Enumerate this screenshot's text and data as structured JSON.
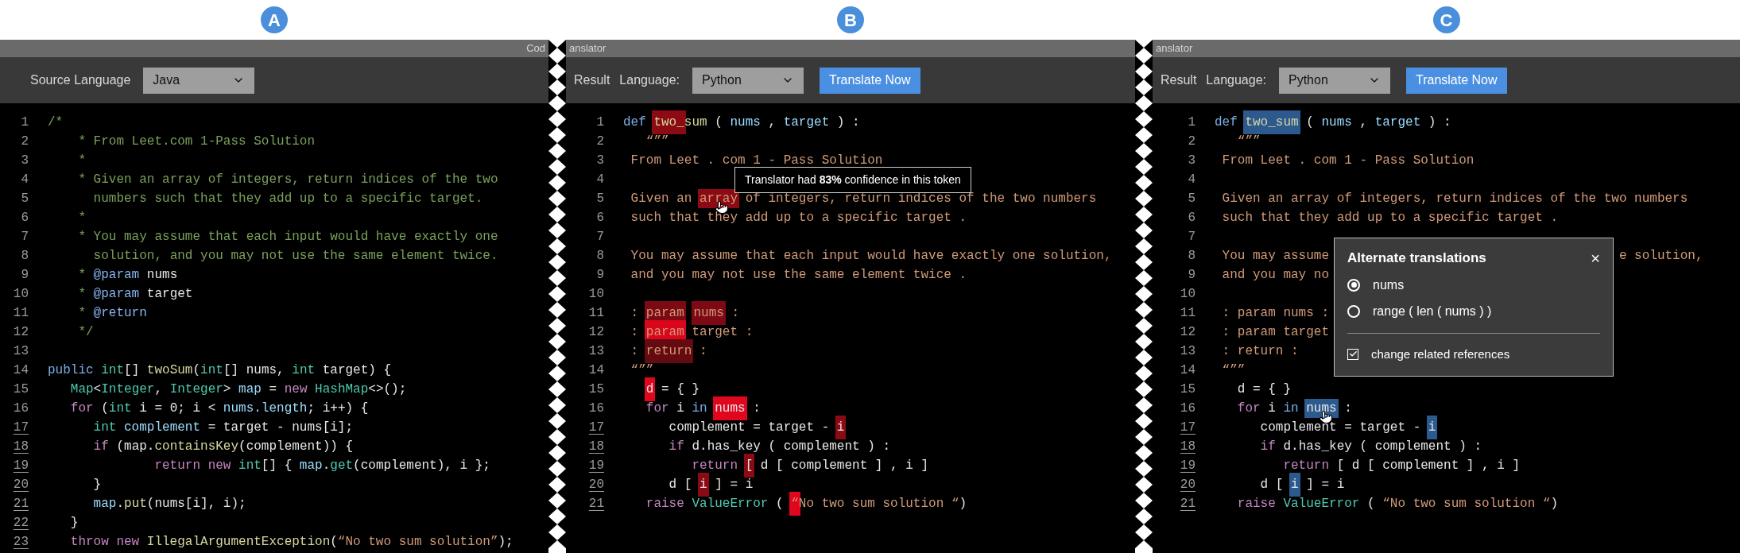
{
  "panels": [
    {
      "label": "A",
      "title": "Cod",
      "toolbar": {
        "labels": [
          "Source Language"
        ],
        "dropdown": "Java"
      },
      "lines": [
        {
          "number": "1",
          "underlined": false,
          "tokens": [
            {
              "text": "/*",
              "kind": "comment"
            }
          ]
        },
        {
          "number": "2",
          "underlined": false,
          "tokens": [
            {
              "text": "    * From Leet.com 1-Pass Solution",
              "kind": "comment"
            }
          ]
        },
        {
          "number": "3",
          "underlined": false,
          "tokens": [
            {
              "text": "    *",
              "kind": "comment"
            }
          ]
        },
        {
          "number": "4",
          "underlined": false,
          "tokens": [
            {
              "text": "    * Given an array of integers, return indices of the two",
              "kind": "comment"
            }
          ]
        },
        {
          "number": "5",
          "underlined": false,
          "tokens": [
            {
              "text": "      numbers such that they add up to a specific target.",
              "kind": "comment"
            }
          ]
        },
        {
          "number": "6",
          "underlined": false,
          "tokens": [
            {
              "text": "    *",
              "kind": "comment"
            }
          ]
        },
        {
          "number": "7",
          "underlined": false,
          "tokens": [
            {
              "text": "    * You may assume that each input would have exactly one",
              "kind": "comment"
            }
          ]
        },
        {
          "number": "8",
          "underlined": false,
          "tokens": [
            {
              "text": "      solution, and you may not use the same element twice.",
              "kind": "comment"
            }
          ]
        },
        {
          "number": "9",
          "underlined": false,
          "tokens": [
            {
              "text": "    * ",
              "kind": "comment"
            },
            {
              "text": "@param",
              "kind": "doctag"
            },
            {
              "text": " nums",
              "kind": "plain"
            }
          ]
        },
        {
          "number": "10",
          "underlined": false,
          "tokens": [
            {
              "text": "    * ",
              "kind": "comment"
            },
            {
              "text": "@param",
              "kind": "doctag"
            },
            {
              "text": " target",
              "kind": "plain"
            }
          ]
        },
        {
          "number": "11",
          "underlined": false,
          "tokens": [
            {
              "text": "    * ",
              "kind": "comment"
            },
            {
              "text": "@return",
              "kind": "doctag"
            }
          ]
        },
        {
          "number": "12",
          "underlined": false,
          "tokens": [
            {
              "text": "    */",
              "kind": "comment"
            }
          ]
        },
        {
          "number": "13",
          "underlined": false
        },
        {
          "number": "14",
          "underlined": false,
          "tokens": [
            {
              "text": "public ",
              "kind": "storage"
            },
            {
              "text": "int",
              "kind": "type"
            },
            {
              "text": "[] ",
              "kind": "plain"
            },
            {
              "text": "twoSum",
              "kind": "func"
            },
            {
              "text": "(",
              "kind": "plain"
            },
            {
              "text": "int",
              "kind": "type"
            },
            {
              "text": "[] nums, ",
              "kind": "plain"
            },
            {
              "text": "int",
              "kind": "type"
            },
            {
              "text": " target) {",
              "kind": "plain"
            }
          ],
          "children": [
            {
              "number": "15",
              "underlined": false,
              "tokens": [
                {
                  "text": "Map",
                  "kind": "type"
                },
                {
                  "text": "<",
                  "kind": "plain"
                },
                {
                  "text": "Integer",
                  "kind": "type"
                },
                {
                  "text": ", ",
                  "kind": "plain"
                },
                {
                  "text": "Integer",
                  "kind": "type"
                },
                {
                  "text": "> ",
                  "kind": "plain"
                },
                {
                  "text": "map",
                  "kind": "var"
                },
                {
                  "text": " = ",
                  "kind": "plain"
                },
                {
                  "text": "new ",
                  "kind": "keyword"
                },
                {
                  "text": "HashMap",
                  "kind": "type"
                },
                {
                  "text": "<>();",
                  "kind": "plain"
                }
              ]
            },
            {
              "number": "16",
              "underlined": false,
              "tokens": [
                {
                  "text": "for ",
                  "kind": "keyword"
                },
                {
                  "text": "(",
                  "kind": "plain"
                },
                {
                  "text": "int",
                  "kind": "type"
                },
                {
                  "text": " i = 0; i < ",
                  "kind": "plain"
                },
                {
                  "text": "nums.length",
                  "kind": "var"
                },
                {
                  "text": "; i++) {",
                  "kind": "plain"
                }
              ],
              "children": [
                {
                  "number": "17",
                  "underlined": true,
                  "tokens": [
                    {
                      "text": "int ",
                      "kind": "type"
                    },
                    {
                      "text": "complement",
                      "kind": "var"
                    },
                    {
                      "text": " = target - nums[i];",
                      "kind": "plain"
                    }
                  ]
                },
                {
                  "number": "18",
                  "underlined": true,
                  "tokens": [
                    {
                      "text": "if ",
                      "kind": "keyword"
                    },
                    {
                      "text": "(map.",
                      "kind": "plain"
                    },
                    {
                      "text": "containsKey",
                      "kind": "func"
                    },
                    {
                      "text": "(complement)) {",
                      "kind": "plain"
                    }
                  ],
                  "children": [
                    {
                      "number": "19",
                      "underlined": true,
                      "tokens": [
                        {
                          "text": "     return new ",
                          "kind": "keyword"
                        },
                        {
                          "text": "int",
                          "kind": "type"
                        },
                        {
                          "text": "[] { ",
                          "kind": "plain"
                        },
                        {
                          "text": "map",
                          "kind": "var"
                        },
                        {
                          "text": ".",
                          "kind": "plain"
                        },
                        {
                          "text": "get",
                          "kind": "type"
                        },
                        {
                          "text": "(complement), i };",
                          "kind": "plain"
                        }
                      ]
                    }
                  ]
                },
                {
                  "number": "20",
                  "underlined": true,
                  "tokens": [
                    {
                      "text": "}",
                      "kind": "plain"
                    }
                  ]
                },
                {
                  "number": "21",
                  "underlined": true,
                  "tokens": [
                    {
                      "text": "map",
                      "kind": "var"
                    },
                    {
                      "text": ".",
                      "kind": "plain"
                    },
                    {
                      "text": "put",
                      "kind": "func"
                    },
                    {
                      "text": "(nums[i], i);",
                      "kind": "plain"
                    }
                  ]
                }
              ]
            },
            {
              "number": "22",
              "underlined": true,
              "tokens": [
                {
                  "text": "}",
                  "kind": "plain"
                }
              ]
            },
            {
              "number": "23",
              "underlined": true,
              "tokens": [
                {
                  "text": "throw new ",
                  "kind": "keyword"
                },
                {
                  "text": "IllegalArgumentException",
                  "kind": "func"
                },
                {
                  "text": "(",
                  "kind": "plain"
                },
                {
                  "text": "“No two sum solution”",
                  "kind": "string"
                },
                {
                  "text": ");",
                  "kind": "plain"
                }
              ]
            }
          ]
        }
      ]
    },
    {
      "label": "B",
      "title": "anslator",
      "toolbar": {
        "labels": [
          "Result",
          "Language:"
        ],
        "dropdown": "Python",
        "button": "Translate Now"
      },
      "tooltip": {
        "text": "Translator had **83%** confidence in this token"
      },
      "lines": [
        {
          "number": "1",
          "underlined": false,
          "tokens": [
            {
              "text": "def ",
              "kind": "storage"
            },
            {
              "text": "two_",
              "kind": "func",
              "color": "#8b0a14"
            },
            {
              "text": "sum",
              "kind": "func"
            },
            {
              "text": " ( ",
              "kind": "plain"
            },
            {
              "text": "nums",
              "kind": "var"
            },
            {
              "text": " , ",
              "kind": "plain"
            },
            {
              "text": "target",
              "kind": "var"
            },
            {
              "text": " ) :",
              "kind": "plain"
            }
          ]
        },
        {
          "number": "2",
          "underlined": false,
          "tokens": [
            {
              "text": "   “””",
              "kind": "string"
            }
          ]
        },
        {
          "number": "3",
          "underlined": false,
          "tokens": [
            {
              "text": " From Leet . com 1 - Pass Solution",
              "kind": "string"
            }
          ]
        },
        {
          "number": "4",
          "underlined": false
        },
        {
          "number": "5",
          "underlined": false,
          "tokens": [
            {
              "text": " Given an ",
              "kind": "string"
            },
            {
              "text": "array",
              "kind": "string",
              "color": "#8b0a14",
              "pointer": true
            },
            {
              "text": " of integers, return indices of the two numbers",
              "kind": "string"
            }
          ]
        },
        {
          "number": "6",
          "underlined": false,
          "tokens": [
            {
              "text": " such that they add up to a specific target .",
              "kind": "string"
            }
          ]
        },
        {
          "number": "7",
          "underlined": false
        },
        {
          "number": "8",
          "underlined": false,
          "tokens": [
            {
              "text": " You may assume that each input would have exactly one solution,",
              "kind": "string"
            }
          ]
        },
        {
          "number": "9",
          "underlined": false,
          "tokens": [
            {
              "text": " and you may not use the same element twice .",
              "kind": "string"
            }
          ]
        },
        {
          "number": "10",
          "underlined": false
        },
        {
          "number": "11",
          "underlined": false,
          "tokens": [
            {
              "text": " : ",
              "kind": "string"
            },
            {
              "text": "param",
              "kind": "string",
              "color": "#7c0913"
            },
            {
              "text": "nums",
              "kind": "string",
              "color": "#7c0913"
            },
            {
              "text": " :",
              "kind": "string"
            }
          ]
        },
        {
          "number": "12",
          "underlined": false,
          "tokens": [
            {
              "text": " : ",
              "kind": "string"
            },
            {
              "text": "param",
              "kind": "string",
              "color": "#d9061c"
            },
            {
              "text": " target :",
              "kind": "string"
            }
          ]
        },
        {
          "number": "13",
          "underlined": false,
          "tokens": [
            {
              "text": " : ",
              "kind": "string"
            },
            {
              "text": "return",
              "kind": "string",
              "color": "#640a10"
            },
            {
              "text": " :",
              "kind": "string"
            }
          ]
        },
        {
          "number": "14",
          "underlined": false,
          "tokens": [
            {
              "text": " “””",
              "kind": "string"
            }
          ],
          "children": [
            {
              "number": "15",
              "underlined": false,
              "tokens": [
                {
                  "text": "d",
                  "kind": "plain",
                  "color": "#e0061d"
                },
                {
                  "text": " = { }",
                  "kind": "plain"
                }
              ]
            },
            {
              "number": "16",
              "underlined": false,
              "tokens": [
                {
                  "text": "for ",
                  "kind": "keyword"
                },
                {
                  "text": "i ",
                  "kind": "plain"
                },
                {
                  "text": "in ",
                  "kind": "storage"
                },
                {
                  "text": "nums",
                  "kind": "plain",
                  "color": "#e0061d"
                },
                {
                  "text": " :",
                  "kind": "plain"
                }
              ],
              "children": [
                {
                  "number": "17",
                  "underlined": true,
                  "tokens": [
                    {
                      "text": "complement = target - ",
                      "kind": "plain"
                    },
                    {
                      "text": "i",
                      "kind": "plain",
                      "color": "#8b0a14"
                    }
                  ]
                },
                {
                  "number": "18",
                  "underlined": true,
                  "tokens": [
                    {
                      "text": "if ",
                      "kind": "keyword"
                    },
                    {
                      "text": "d.has_key ( complement ) :",
                      "kind": "plain"
                    }
                  ],
                  "children": [
                    {
                      "number": "19",
                      "underlined": true,
                      "tokens": [
                        {
                          "text": "return ",
                          "kind": "keyword"
                        },
                        {
                          "text": "[",
                          "kind": "plain",
                          "color": "#8b0a14"
                        },
                        {
                          "text": " d [ complement ] , i ]",
                          "kind": "plain"
                        }
                      ]
                    }
                  ]
                },
                {
                  "number": "20",
                  "underlined": true,
                  "tokens": [
                    {
                      "text": "d [ ",
                      "kind": "plain"
                    },
                    {
                      "text": "i",
                      "kind": "plain",
                      "color": "#8b0a14"
                    },
                    {
                      "text": " ] = i",
                      "kind": "plain"
                    }
                  ]
                }
              ]
            },
            {
              "number": "21",
              "underlined": true,
              "tokens": [
                {
                  "text": "raise ",
                  "kind": "keyword"
                },
                {
                  "text": "ValueError",
                  "kind": "type"
                },
                {
                  "text": " ( ",
                  "kind": "plain"
                },
                {
                  "text": "“",
                  "kind": "string",
                  "color": "#e0061d"
                },
                {
                  "text": "No two sum solution “",
                  "kind": "string"
                },
                {
                  "text": ")",
                  "kind": "plain"
                }
              ]
            }
          ]
        }
      ]
    },
    {
      "label": "C",
      "title": "anslator",
      "toolbar": {
        "labels": [
          "Result",
          "Language:"
        ],
        "dropdown": "Python",
        "button": "Translate Now"
      },
      "popup": {
        "title": "Alternate translations",
        "close": "×",
        "options": [
          {
            "label": "nums",
            "selected": true
          },
          {
            "label": "range ( len ( nums ) )",
            "selected": false
          }
        ],
        "checkbox": {
          "label": "change related references",
          "checked": true
        }
      },
      "lines": [
        {
          "number": "1",
          "underlined": false,
          "tokens": [
            {
              "text": "def ",
              "kind": "storage"
            },
            {
              "text": "two_sum",
              "kind": "func",
              "color": "#2d5a8e"
            },
            {
              "text": " ( ",
              "kind": "plain"
            },
            {
              "text": "nums",
              "kind": "var"
            },
            {
              "text": " , ",
              "kind": "plain"
            },
            {
              "text": "target",
              "kind": "var"
            },
            {
              "text": " ) :",
              "kind": "plain"
            }
          ]
        },
        {
          "number": "2",
          "underlined": false,
          "tokens": [
            {
              "text": "   “””",
              "kind": "string"
            }
          ]
        },
        {
          "number": "3",
          "underlined": false,
          "tokens": [
            {
              "text": " From Leet . com 1 - Pass Solution",
              "kind": "string"
            }
          ]
        },
        {
          "number": "4",
          "underlined": false
        },
        {
          "number": "5",
          "underlined": false,
          "tokens": [
            {
              "text": " Given an array of integers, return indices of the two numbers",
              "kind": "string"
            }
          ]
        },
        {
          "number": "6",
          "underlined": false,
          "tokens": [
            {
              "text": " such that they add up to a specific target .",
              "kind": "string"
            }
          ]
        },
        {
          "number": "7",
          "underlined": false
        },
        {
          "number": "8",
          "underlined": false,
          "tokens": [
            {
              "text": " You may assume",
              "kind": "string"
            },
            {
              "text": "e solution,",
              "kind": "string",
              "covered_before": true
            }
          ]
        },
        {
          "number": "9",
          "underlined": false,
          "tokens": [
            {
              "text": " and you may no",
              "kind": "string"
            }
          ]
        },
        {
          "number": "10",
          "underlined": false
        },
        {
          "number": "11",
          "underlined": false,
          "tokens": [
            {
              "text": " : param nums :",
              "kind": "string"
            }
          ]
        },
        {
          "number": "12",
          "underlined": false,
          "tokens": [
            {
              "text": " : param target",
              "kind": "string"
            }
          ]
        },
        {
          "number": "13",
          "underlined": false,
          "tokens": [
            {
              "text": " : return :",
              "kind": "string"
            }
          ]
        },
        {
          "number": "14",
          "underlined": false,
          "tokens": [
            {
              "text": " “””",
              "kind": "string"
            }
          ],
          "children": [
            {
              "number": "15",
              "underlined": false,
              "tokens": [
                {
                  "text": "d = { }",
                  "kind": "plain"
                }
              ]
            },
            {
              "number": "16",
              "underlined": false,
              "tokens": [
                {
                  "text": "for ",
                  "kind": "keyword"
                },
                {
                  "text": "i ",
                  "kind": "plain"
                },
                {
                  "text": "in ",
                  "kind": "storage"
                },
                {
                  "text": "nums",
                  "kind": "plain",
                  "color": "#2d5a8e",
                  "pointer": true
                },
                {
                  "text": " :",
                  "kind": "plain"
                }
              ],
              "children": [
                {
                  "number": "17",
                  "underlined": true,
                  "tokens": [
                    {
                      "text": "complement = target - ",
                      "kind": "plain"
                    },
                    {
                      "text": "i",
                      "kind": "plain",
                      "color": "#2d5a8e"
                    }
                  ]
                },
                {
                  "number": "18",
                  "underlined": true,
                  "tokens": [
                    {
                      "text": "if ",
                      "kind": "keyword"
                    },
                    {
                      "text": "d.has_key ( complement ) :",
                      "kind": "plain"
                    }
                  ],
                  "children": [
                    {
                      "number": "19",
                      "underlined": true,
                      "tokens": [
                        {
                          "text": "return ",
                          "kind": "keyword"
                        },
                        {
                          "text": "[ d [ complement ] , i ]",
                          "kind": "plain"
                        }
                      ]
                    }
                  ]
                },
                {
                  "number": "20",
                  "underlined": true,
                  "tokens": [
                    {
                      "text": "d [ ",
                      "kind": "plain"
                    },
                    {
                      "text": "i",
                      "kind": "plain",
                      "color": "#2d5a8e"
                    },
                    {
                      "text": " ] = i",
                      "kind": "plain"
                    }
                  ]
                }
              ]
            },
            {
              "number": "21",
              "underlined": true,
              "tokens": [
                {
                  "text": "raise ",
                  "kind": "keyword"
                },
                {
                  "text": "ValueError",
                  "kind": "type"
                },
                {
                  "text": " ( ",
                  "kind": "plain"
                },
                {
                  "text": "“No two sum solution “",
                  "kind": "string"
                },
                {
                  "text": ")",
                  "kind": "plain"
                }
              ]
            }
          ]
        }
      ]
    }
  ]
}
